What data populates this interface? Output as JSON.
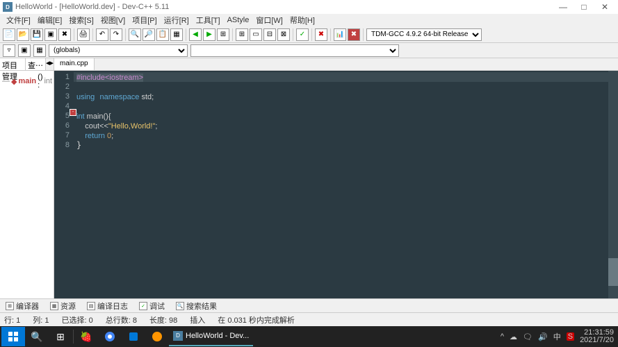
{
  "window": {
    "title": "HelloWorld - [HelloWorld.dev] - Dev-C++ 5.11",
    "min_icon": "—",
    "max_icon": "□",
    "close_icon": "✕"
  },
  "menu": [
    "文件[F]",
    "编辑[E]",
    "搜索[S]",
    "视图[V]",
    "项目[P]",
    "运行[R]",
    "工具[T]",
    "AStyle",
    "窗口[W]",
    "帮助[H]"
  ],
  "compiler_combo": "TDM-GCC 4.9.2 64-bit Release",
  "scope_combo": "(globals)",
  "sidebar": {
    "tabs": [
      "项目管理",
      "查⋯"
    ],
    "tree": {
      "fn": "main",
      "sig": "() :",
      "ret": "int"
    }
  },
  "editor": {
    "tab": "main.cpp",
    "code": {
      "l1": [
        "#include",
        "<iostream>"
      ],
      "l2": "",
      "l3": [
        "using",
        "namespace",
        " std;"
      ],
      "l4": "",
      "l5": [
        "int",
        " main(){"
      ],
      "l6_pre": "    cout<<",
      "l6_str": "\"Hello,World!\"",
      "l6_post": ";",
      "l7": [
        "    ",
        "return",
        " ",
        "0",
        ";"
      ],
      "l8": "}"
    },
    "gutter": [
      "1",
      "2",
      "3",
      "4",
      "5",
      "6",
      "7",
      "8"
    ]
  },
  "bottomtabs": [
    {
      "icon": "⊞",
      "label": "编译器"
    },
    {
      "icon": "▦",
      "label": "资源"
    },
    {
      "icon": "▤",
      "label": "编译日志"
    },
    {
      "icon": "✓",
      "label": "调试"
    },
    {
      "icon": "🔍",
      "label": "搜索结果"
    }
  ],
  "statusbar": {
    "line": "行: 1",
    "col": "列: 1",
    "sel": "已选择: 0",
    "total": "总行数: 8",
    "len": "长度: 98",
    "mode": "插入",
    "parse": "在 0.031 秒内完成解析"
  },
  "taskbar": {
    "activeapp": "HelloWorld - Dev...",
    "time": "21:31:59",
    "date": "2021/7/20",
    "tray_icons": [
      "^",
      "☁",
      "🗨",
      "🔊",
      "中",
      "S"
    ]
  }
}
